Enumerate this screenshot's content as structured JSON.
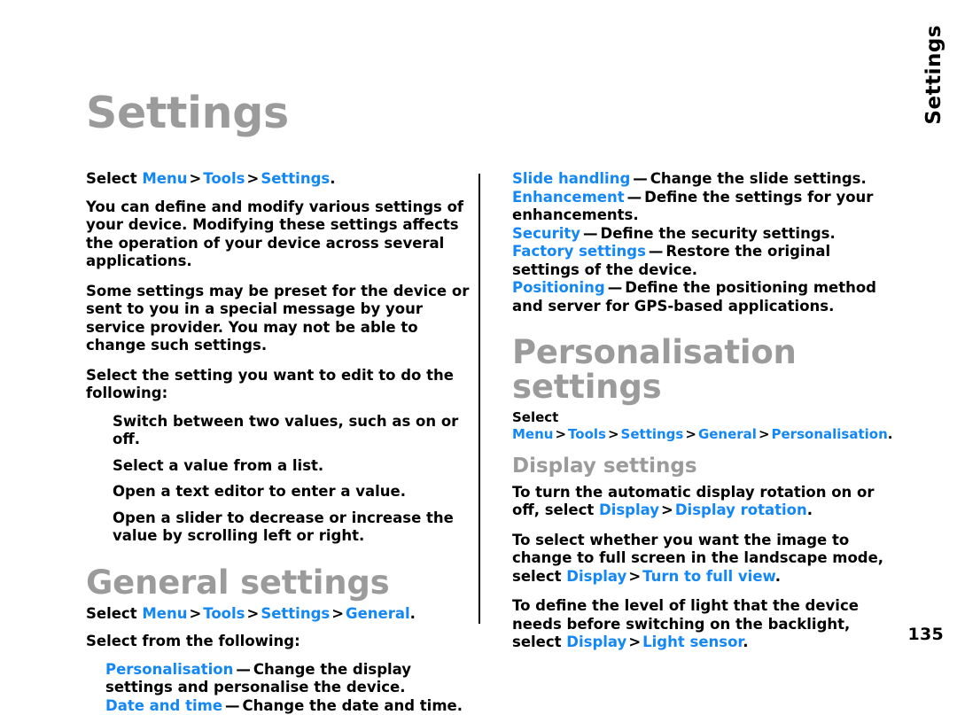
{
  "running_head": "Settings",
  "page_title": "Settings",
  "folio": "135",
  "colors": {
    "link_blue": "#1287f5",
    "heading_gray": "#9b9b9b",
    "body_black": "#000000"
  },
  "left_column": {
    "breadcrumb_intro": {
      "prefix": "Select ",
      "crumbs": [
        "Menu",
        "Tools",
        "Settings"
      ],
      "separator": ">",
      "suffix": "."
    },
    "paragraphs": [
      "You can define and modify various settings of your device. Modifying these settings affects the operation of your device across several applications.",
      "Some settings may be preset for the device or sent to you in a special message by your service provider. You may not be able to change such settings.",
      "Select the setting you want to edit to do the following:"
    ],
    "option_list": [
      "Switch between two values, such as on or off.",
      "Select a value from a list.",
      "Open a text editor to enter a value.",
      "Open a slider to decrease or increase the value by scrolling left or right."
    ],
    "section_heading": "General settings",
    "section_breadcrumb": {
      "prefix": "Select ",
      "crumbs": [
        "Menu",
        "Tools",
        "Settings",
        "General"
      ],
      "separator": ">",
      "suffix": "."
    },
    "select_from_following": "Select from the following:",
    "definitions": [
      {
        "term": "Personalisation",
        "desc": "Change the display settings and personalise the device."
      },
      {
        "term": "Date and time",
        "desc": "Change the date and time."
      }
    ]
  },
  "right_column": {
    "definitions": [
      {
        "term": "Slide handling",
        "desc": "Change the slide settings."
      },
      {
        "term": "Enhancement",
        "desc": "Define the settings for your enhancements."
      },
      {
        "term": "Security",
        "desc": "Define the security settings."
      },
      {
        "term": "Factory settings",
        "desc": "Restore the original settings of the device."
      },
      {
        "term": "Positioning",
        "desc": "Define the positioning method and server for GPS-based applications."
      }
    ],
    "section_heading": "Personalisation settings",
    "section_breadcrumb": {
      "prefix": "Select ",
      "crumbs": [
        "Menu",
        "Tools",
        "Settings",
        "General",
        "Personalisation"
      ],
      "separator": ">",
      "suffix": "."
    },
    "subsection_heading": "Display settings",
    "instructions": [
      {
        "lead": "To turn the automatic display rotation on or off, select ",
        "crumbs": [
          "Display",
          "Display rotation"
        ],
        "separator": ">",
        "suffix": "."
      },
      {
        "lead": "To select whether you want the image to change to full screen in the landscape mode, select ",
        "crumbs": [
          "Display",
          "Turn to full view"
        ],
        "separator": ">",
        "suffix": "."
      },
      {
        "lead": "To define the level of light that the device needs before switching on the backlight, select ",
        "crumbs": [
          "Display",
          "Light sensor"
        ],
        "separator": ">",
        "suffix": "."
      }
    ]
  }
}
